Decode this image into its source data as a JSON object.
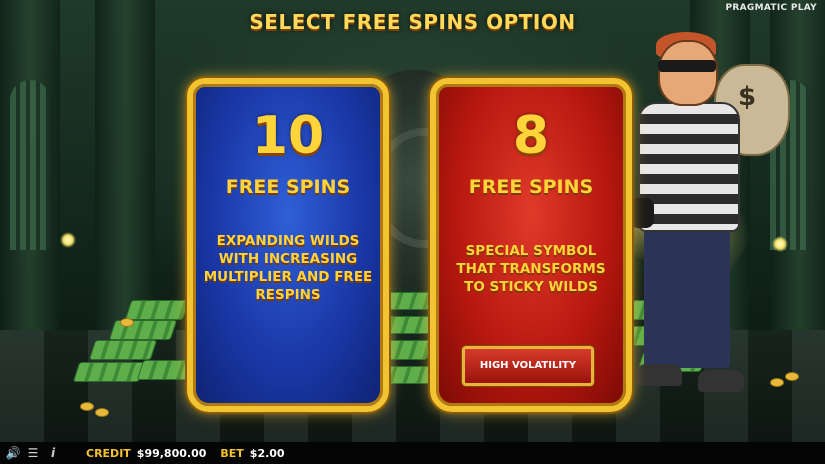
{
  "header": {
    "title": "SELECT FREE SPINS OPTION",
    "brand": "PRAGMATIC PLAY"
  },
  "options": [
    {
      "count": "10",
      "label": "FREE SPINS",
      "description": "EXPANDING WILDS WITH INCREASING MULTIPLIER AND FREE RESPINS",
      "color": "#1a38a8"
    },
    {
      "count": "8",
      "label": "FREE SPINS",
      "description": "SPECIAL SYMBOL THAT TRANSFORMS TO STICKY WILDS",
      "badge": "HIGH VOLATILITY",
      "color": "#b8180f"
    }
  ],
  "accent_color": "#ffd33a",
  "bottom_bar": {
    "icons": [
      "sound-icon",
      "menu-icon",
      "info-icon"
    ],
    "credit_label": "CREDIT",
    "credit_value": "$99,800.00",
    "bet_label": "BET",
    "bet_value": "$2.00"
  }
}
